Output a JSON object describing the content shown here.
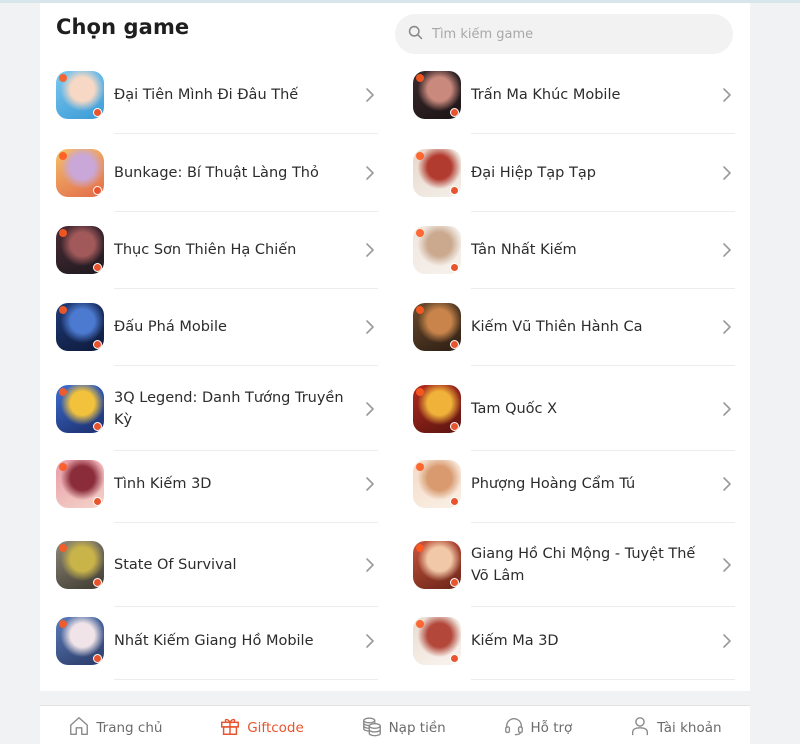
{
  "header": {
    "title": "Chọn game",
    "search_placeholder": "Tìm kiếm game"
  },
  "games": [
    {
      "name": "Đại Tiên Mình Đi Đâu Thế",
      "icon": "game-icon-dai-tien",
      "colors": [
        "#7ec8f0",
        "#f7d8c4",
        "#3a9bd6"
      ]
    },
    {
      "name": "Trấn Ma Khúc Mobile",
      "icon": "game-icon-tran-ma-khuc",
      "colors": [
        "#3b2a2e",
        "#c9897c",
        "#1c1416"
      ]
    },
    {
      "name": "Bunkage: Bí Thuật Làng Thỏ",
      "icon": "game-icon-bunkage",
      "colors": [
        "#f4c16b",
        "#c9a7d8",
        "#e26b4a"
      ]
    },
    {
      "name": "Đại Hiệp Tạp Tạp",
      "icon": "game-icon-dai-hiep",
      "colors": [
        "#e9d6c8",
        "#b23b2f",
        "#f2efe9"
      ]
    },
    {
      "name": "Thục Sơn Thiên Hạ Chiến",
      "icon": "game-icon-thuc-son",
      "colors": [
        "#4b2b34",
        "#a1595a",
        "#1e1a20"
      ]
    },
    {
      "name": "Tân Nhất Kiếm",
      "icon": "game-icon-tan-nhat-kiem",
      "colors": [
        "#efe6de",
        "#caa98f",
        "#f7f1ec"
      ]
    },
    {
      "name": "Đấu Phá Mobile",
      "icon": "game-icon-dau-pha",
      "colors": [
        "#1f3a78",
        "#4c7ad0",
        "#0e1a3a"
      ]
    },
    {
      "name": "Kiếm Vũ Thiên Hành Ca",
      "icon": "game-icon-kiem-vu",
      "colors": [
        "#6b4a2c",
        "#c8844a",
        "#2c1e14"
      ]
    },
    {
      "name": "3Q Legend: Danh Tướng Truyền Kỳ",
      "icon": "game-icon-3q-legend",
      "colors": [
        "#3d6ed1",
        "#f2c23c",
        "#1b2e6b"
      ]
    },
    {
      "name": "Tam Quốc X",
      "icon": "game-icon-tam-quoc-x",
      "colors": [
        "#b22b1e",
        "#f1b23a",
        "#5a1410"
      ]
    },
    {
      "name": "Tình Kiếm 3D",
      "icon": "game-icon-tinh-kiem",
      "colors": [
        "#e89aa6",
        "#8a2c3a",
        "#f4d3c9"
      ]
    },
    {
      "name": "Phượng Hoàng Cẩm Tú",
      "icon": "game-icon-phuong-hoang",
      "colors": [
        "#f3d9c6",
        "#d89a6e",
        "#faf0e6"
      ]
    },
    {
      "name": "State Of Survival",
      "icon": "game-icon-state-of-survival",
      "colors": [
        "#8d8778",
        "#c9b44a",
        "#3f3a30"
      ]
    },
    {
      "name": "Giang Hồ Chi Mộng - Tuyệt Thế Võ Lâm",
      "icon": "game-icon-giang-ho",
      "colors": [
        "#c9553e",
        "#f2c9a8",
        "#6a2418"
      ]
    },
    {
      "name": "Nhất Kiếm Giang Hồ Mobile",
      "icon": "game-icon-nhat-kiem-giang-ho",
      "colors": [
        "#5a7bb8",
        "#f0e4e8",
        "#2a3a66"
      ]
    },
    {
      "name": "Kiếm Ma 3D",
      "icon": "game-icon-kiem-ma",
      "colors": [
        "#e9dcd0",
        "#b2473a",
        "#faf3ee"
      ]
    }
  ],
  "nav": [
    {
      "label": "Trang chủ",
      "icon": "home-icon",
      "active": false
    },
    {
      "label": "Giftcode",
      "icon": "gift-icon",
      "active": true
    },
    {
      "label": "Nạp tiền",
      "icon": "coins-icon",
      "active": false
    },
    {
      "label": "Hỗ trợ",
      "icon": "headset-icon",
      "active": false
    },
    {
      "label": "Tài khoản",
      "icon": "user-icon",
      "active": false
    }
  ],
  "colors": {
    "accent": "#e8542d",
    "text": "#2c2c2c",
    "muted": "#6b6b6b"
  }
}
